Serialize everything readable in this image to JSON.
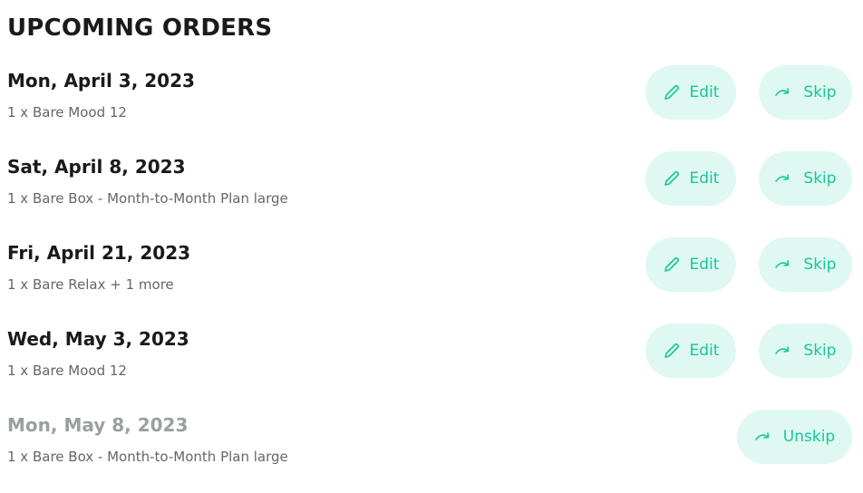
{
  "page": {
    "title": "UPCOMING ORDERS"
  },
  "colors": {
    "accent": "#17c79a",
    "button_bg": "#dff8f2",
    "text_primary": "#1a1a1a",
    "text_secondary": "#666666",
    "text_muted": "#9aa0a0"
  },
  "actions": {
    "edit_label": "Edit",
    "skip_label": "Skip",
    "unskip_label": "Unskip",
    "edit_icon": "pencil-icon",
    "skip_icon": "redo-arrow-icon"
  },
  "orders": [
    {
      "date": "Mon, April 3, 2023",
      "items": "1 x Bare Mood 12",
      "skipped": false
    },
    {
      "date": "Sat, April 8, 2023",
      "items": "1 x Bare Box - Month-to-Month Plan large",
      "skipped": false
    },
    {
      "date": "Fri, April 21, 2023",
      "items": "1 x Bare Relax + 1 more",
      "skipped": false
    },
    {
      "date": "Wed, May 3, 2023",
      "items": "1 x Bare Mood 12",
      "skipped": false
    },
    {
      "date": "Mon, May 8, 2023",
      "items": "1 x Bare Box - Month-to-Month Plan large",
      "skipped": true
    }
  ]
}
